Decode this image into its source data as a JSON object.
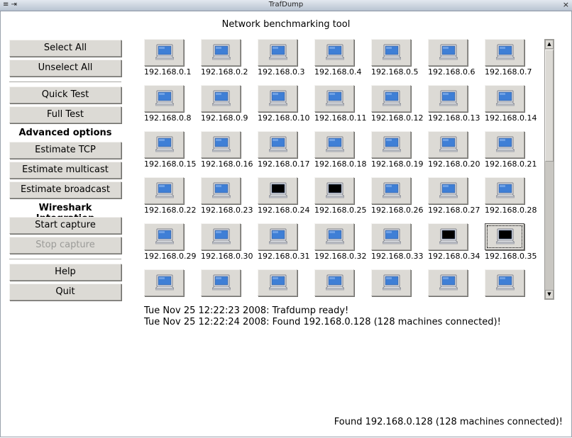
{
  "window": {
    "title": "TrafDump",
    "left_glyph": "≡ ⇥",
    "close_glyph": "×"
  },
  "header": {
    "title": "Network benchmarking tool"
  },
  "sidebar": {
    "select_all": "Select All",
    "unselect_all": "Unselect All",
    "quick_test": "Quick Test",
    "full_test": "Full Test",
    "advanced_heading": "Advanced options",
    "estimate_tcp": "Estimate TCP",
    "estimate_multicast": "Estimate multicast",
    "estimate_broadcast": "Estimate broadcast",
    "wireshark_heading": "Wireshark Integration",
    "start_capture": "Start capture",
    "stop_capture": "Stop capture",
    "help": "Help",
    "quit": "Quit"
  },
  "machines": [
    {
      "ip": "192.168.0.1",
      "state": "on"
    },
    {
      "ip": "192.168.0.2",
      "state": "on"
    },
    {
      "ip": "192.168.0.3",
      "state": "on"
    },
    {
      "ip": "192.168.0.4",
      "state": "on"
    },
    {
      "ip": "192.168.0.5",
      "state": "on"
    },
    {
      "ip": "192.168.0.6",
      "state": "on"
    },
    {
      "ip": "192.168.0.7",
      "state": "on"
    },
    {
      "ip": "192.168.0.8",
      "state": "on"
    },
    {
      "ip": "192.168.0.9",
      "state": "on"
    },
    {
      "ip": "192.168.0.10",
      "state": "on"
    },
    {
      "ip": "192.168.0.11",
      "state": "on"
    },
    {
      "ip": "192.168.0.12",
      "state": "on"
    },
    {
      "ip": "192.168.0.13",
      "state": "on"
    },
    {
      "ip": "192.168.0.14",
      "state": "on"
    },
    {
      "ip": "192.168.0.15",
      "state": "on"
    },
    {
      "ip": "192.168.0.16",
      "state": "on"
    },
    {
      "ip": "192.168.0.17",
      "state": "on"
    },
    {
      "ip": "192.168.0.18",
      "state": "on"
    },
    {
      "ip": "192.168.0.19",
      "state": "on"
    },
    {
      "ip": "192.168.0.20",
      "state": "on"
    },
    {
      "ip": "192.168.0.21",
      "state": "on"
    },
    {
      "ip": "192.168.0.22",
      "state": "on"
    },
    {
      "ip": "192.168.0.23",
      "state": "on"
    },
    {
      "ip": "192.168.0.24",
      "state": "off"
    },
    {
      "ip": "192.168.0.25",
      "state": "off"
    },
    {
      "ip": "192.168.0.26",
      "state": "on"
    },
    {
      "ip": "192.168.0.27",
      "state": "on"
    },
    {
      "ip": "192.168.0.28",
      "state": "on"
    },
    {
      "ip": "192.168.0.29",
      "state": "on"
    },
    {
      "ip": "192.168.0.30",
      "state": "on"
    },
    {
      "ip": "192.168.0.31",
      "state": "on"
    },
    {
      "ip": "192.168.0.32",
      "state": "on"
    },
    {
      "ip": "192.168.0.33",
      "state": "on"
    },
    {
      "ip": "192.168.0.34",
      "state": "off"
    },
    {
      "ip": "192.168.0.35",
      "state": "off",
      "focused": true
    },
    {
      "ip": "",
      "state": "on"
    },
    {
      "ip": "",
      "state": "on"
    },
    {
      "ip": "",
      "state": "on"
    },
    {
      "ip": "",
      "state": "on"
    },
    {
      "ip": "",
      "state": "on"
    },
    {
      "ip": "",
      "state": "on"
    },
    {
      "ip": "",
      "state": "on"
    }
  ],
  "log": [
    "Tue Nov 25 12:22:23 2008: Trafdump ready!",
    "Tue Nov 25 12:22:24 2008: Found 192.168.0.128 (128 machines connected)!"
  ],
  "status": "Found 192.168.0.128 (128 machines connected)!",
  "scrollbar": {
    "up": "▲",
    "down": "▼"
  },
  "colors": {
    "screen_on": "#3f7fd6",
    "screen_off": "#000000",
    "button_face": "#dcdad5"
  }
}
